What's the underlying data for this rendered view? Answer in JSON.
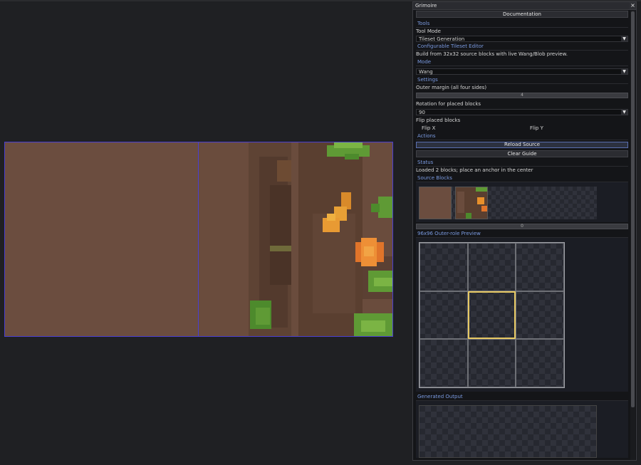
{
  "panel": {
    "title": "Grimoire",
    "close_glyph": "×",
    "documentation_button": "Documentation",
    "tools_section": "Tools",
    "tool_mode_label": "Tool Mode",
    "tool_mode_value": "Tileset Generation",
    "editor_section": "Configurable Tileset Editor",
    "editor_description": "Build from 32x32 source blocks with live Wang/Blob preview.",
    "mode_section": "Mode",
    "mode_value": "Wang",
    "settings_section": "Settings",
    "outer_margin_label": "Outer margin (all four sides)",
    "outer_margin_value": "4",
    "rotation_label": "Rotation for placed blocks",
    "rotation_value": "90",
    "flip_label": "Flip placed blocks",
    "flip_x": "Flip X",
    "flip_y": "Flip Y",
    "actions_section": "Actions",
    "reload_button": "Reload Source",
    "clear_button": "Clear Guide",
    "status_section": "Status",
    "status_text": "Loaded 2 blocks; place an anchor in the center",
    "source_section": "Source Blocks",
    "source_slider_value": "0",
    "preview_section": "96x96 Outer-role Preview",
    "output_section": "Generated Output",
    "dropdown_arrow": "▼"
  },
  "colors": {
    "accent_section": "#7a9ae0",
    "canvas_border": "#4a3fd1",
    "dirt": "#6b4d3f",
    "grass": "#5f9a35",
    "leaf_orange": "#e8902b",
    "highlight_cell": "#e6c862"
  }
}
